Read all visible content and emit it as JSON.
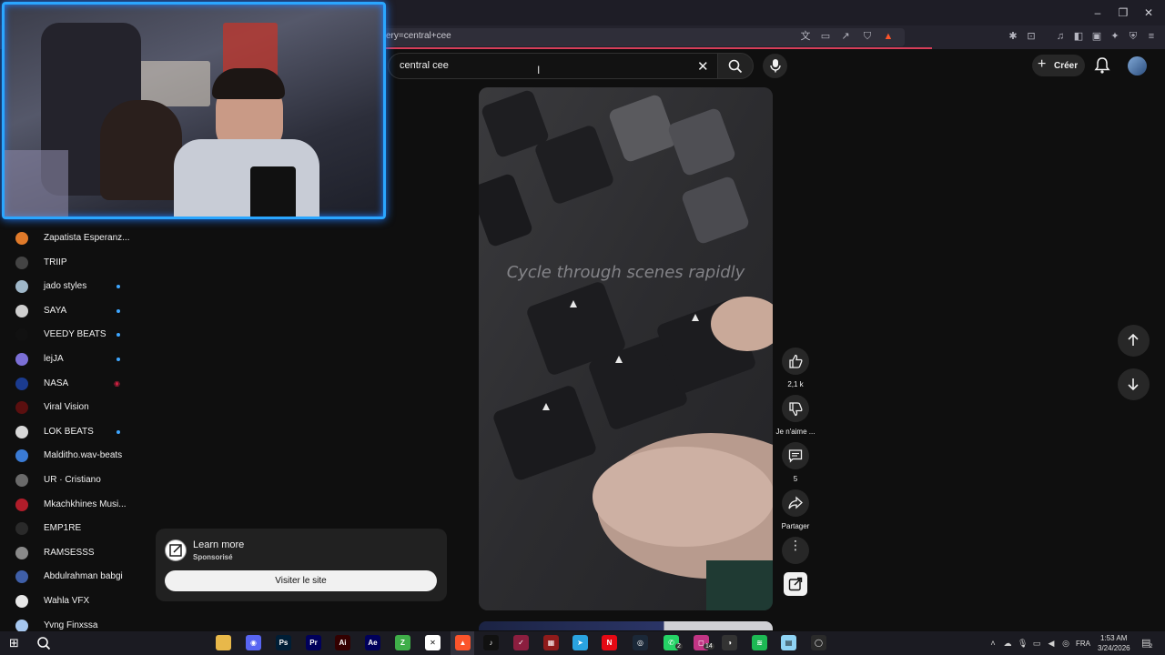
{
  "browser": {
    "url_fragment": "ery=central+cee",
    "window_controls": [
      "minimize-icon",
      "restore-icon",
      "close-icon"
    ]
  },
  "header": {
    "search_value": "central cee",
    "create_label": "Créer"
  },
  "sidebar": {
    "items": [
      {
        "label": "Zapatista Esperanz...",
        "color": "#e07a2a",
        "badge": "none"
      },
      {
        "label": "TRIIP",
        "color": "#444444",
        "badge": "none"
      },
      {
        "label": "jado styles",
        "color": "#9fb7c9",
        "badge": "dot"
      },
      {
        "label": "SAYA",
        "color": "#cfcfcf",
        "badge": "dot"
      },
      {
        "label": "VEEDY BEATS",
        "color": "#111111",
        "badge": "dot"
      },
      {
        "label": "lejJA",
        "color": "#7b6fd6",
        "badge": "dot"
      },
      {
        "label": "NASA",
        "color": "#1b3b8f",
        "badge": "live"
      },
      {
        "label": "Viral Vision",
        "color": "#5a0f0f",
        "badge": "none"
      },
      {
        "label": "LOK BEATS",
        "color": "#d8d8d8",
        "badge": "dot"
      },
      {
        "label": "Malditho.wav-beats",
        "color": "#3a7bd5",
        "badge": "none"
      },
      {
        "label": "UR · Cristiano",
        "color": "#6a6a6a",
        "badge": "none"
      },
      {
        "label": "Mkachkhines Musi...",
        "color": "#b01d2a",
        "badge": "none"
      },
      {
        "label": "EMP1RE",
        "color": "#2a2a2a",
        "badge": "none"
      },
      {
        "label": "RAMSESSS",
        "color": "#8a8a8a",
        "badge": "none"
      },
      {
        "label": "Abdulrahman babgi",
        "color": "#3f5fa8",
        "badge": "none"
      },
      {
        "label": "Wahla VFX",
        "color": "#e8e8e8",
        "badge": "none"
      },
      {
        "label": "Yvng Finxssa",
        "color": "#a6c7ef",
        "badge": "none"
      }
    ]
  },
  "short": {
    "caption": "Cycle through scenes rapidly",
    "like_count": "2,1 k",
    "dislike_label": "Je n'aime ...",
    "comment_count": "5",
    "share_label": "Partager"
  },
  "ad": {
    "title": "Learn more",
    "sponsored": "Sponsorisé",
    "cta": "Visiter le site"
  },
  "taskbar": {
    "apps": [
      {
        "icon": "file-explorer-icon",
        "color": "#e8b84a",
        "glyph": ""
      },
      {
        "icon": "discord-icon",
        "color": "#5865f2",
        "glyph": "◉"
      },
      {
        "icon": "photoshop-icon",
        "color": "#001e36",
        "glyph": "Ps"
      },
      {
        "icon": "premiere-icon",
        "color": "#00005b",
        "glyph": "Pr"
      },
      {
        "icon": "illustrator-icon",
        "color": "#330000",
        "glyph": "Ai"
      },
      {
        "icon": "after-effects-icon",
        "color": "#00005b",
        "glyph": "Ae"
      },
      {
        "icon": "green-app-icon",
        "color": "#3fae49",
        "glyph": "Z"
      },
      {
        "icon": "capcut-icon",
        "color": "#ffffff",
        "glyph": "✕"
      },
      {
        "icon": "brave-icon",
        "color": "#fb542b",
        "glyph": "▲"
      },
      {
        "icon": "tiktok-icon",
        "color": "#111111",
        "glyph": "♪"
      },
      {
        "icon": "fl-studio-icon",
        "color": "#8b1e3f",
        "glyph": "✓"
      },
      {
        "icon": "red-app-icon",
        "color": "#8e1b1b",
        "glyph": "▦"
      },
      {
        "icon": "telegram-icon",
        "color": "#2aa3e0",
        "glyph": "➤"
      },
      {
        "icon": "netflix-icon",
        "color": "#e50914",
        "glyph": "N"
      },
      {
        "icon": "steam-icon",
        "color": "#1b2838",
        "glyph": "◎"
      },
      {
        "icon": "whatsapp-icon",
        "color": "#25d366",
        "glyph": "✆"
      },
      {
        "icon": "instagram-icon",
        "color": "#c13584",
        "glyph": "◻"
      },
      {
        "icon": "chrome-app-icon",
        "color": "#333333",
        "glyph": "◑"
      },
      {
        "icon": "spotify-icon",
        "color": "#1db954",
        "glyph": "≋"
      },
      {
        "icon": "notepad-icon",
        "color": "#8fd3f4",
        "glyph": "▤"
      },
      {
        "icon": "obs-icon",
        "color": "#2a2a2a",
        "glyph": "◯"
      }
    ],
    "badge_whatsapp": "2",
    "badge_instagram": "14",
    "lang": "FRA",
    "time": "1:53 AM",
    "date": "3/24/2026",
    "notif_count": "2"
  }
}
